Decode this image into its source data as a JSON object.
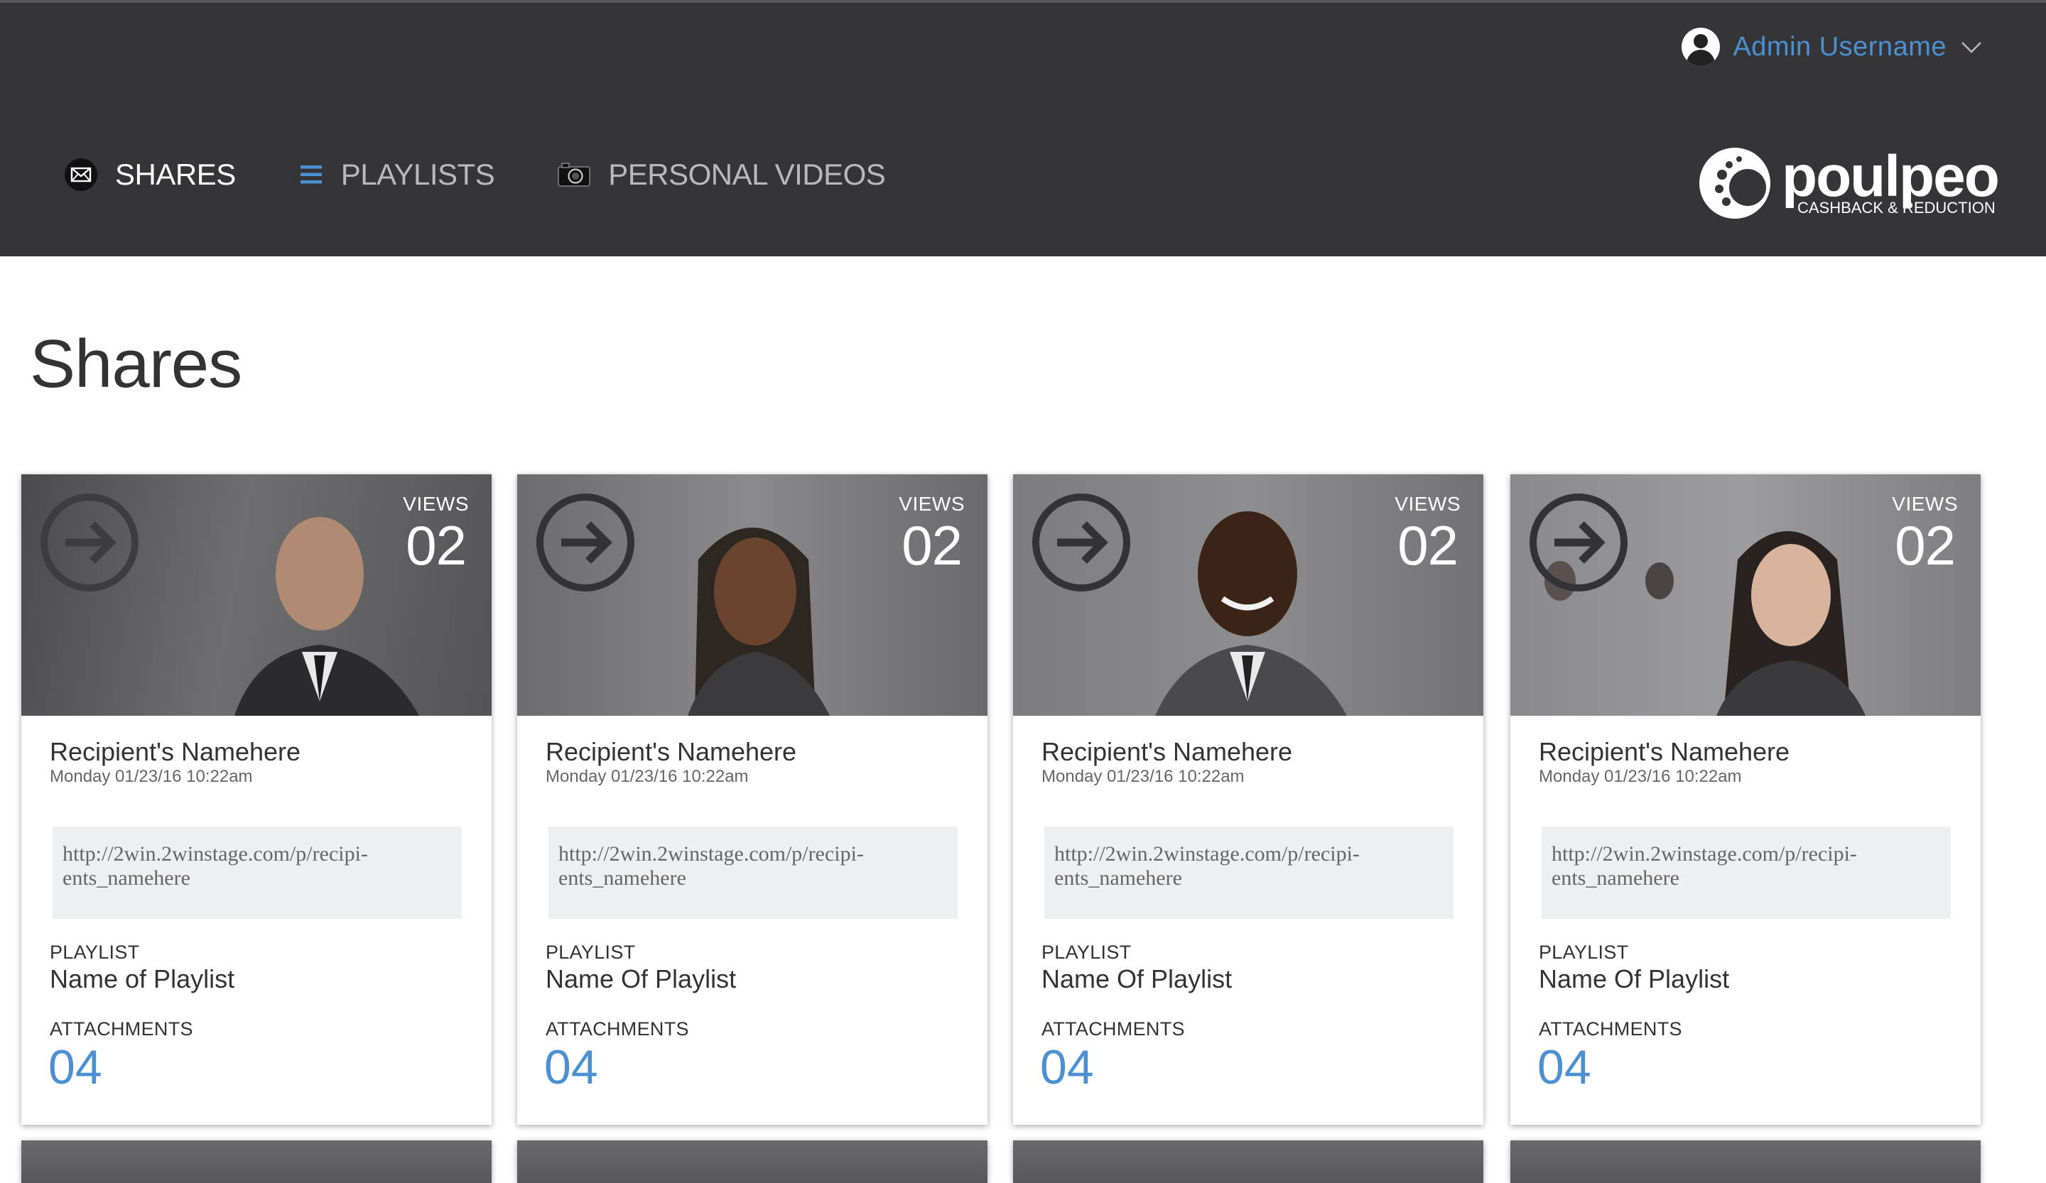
{
  "header": {
    "user_name": "Admin Username",
    "nav": [
      {
        "label": "SHARES",
        "icon": "envelope-icon",
        "active": true
      },
      {
        "label": "PLAYLISTS",
        "icon": "list-icon",
        "active": false
      },
      {
        "label": "PERSONAL VIDEOS",
        "icon": "camera-icon",
        "active": false
      }
    ],
    "logo": {
      "word": "poulpeo",
      "tagline": "CASHBACK & REDUCTION"
    }
  },
  "colors": {
    "header_bg": "#353537",
    "accent": "#4a90d2",
    "link_box_bg": "#eeeff0"
  },
  "page": {
    "title": "Shares"
  },
  "cards": [
    {
      "views_label": "VIEWS",
      "views": "02",
      "recipient": "Recipient's Namehere",
      "date": "Monday 01/23/16 10:22am",
      "link_line1": "http://2win.2winstage.com/p/recipi-",
      "link_line2": "ents_namehere",
      "playlist_label": "PLAYLIST",
      "playlist_name": "Name of Playlist",
      "attachments_label": "ATTACHMENTS",
      "attachments": "04"
    },
    {
      "views_label": "VIEWS",
      "views": "02",
      "recipient": "Recipient's Namehere",
      "date": "Monday 01/23/16 10:22am",
      "link_line1": "http://2win.2winstage.com/p/recipi-",
      "link_line2": "ents_namehere",
      "playlist_label": "PLAYLIST",
      "playlist_name": "Name Of Playlist",
      "attachments_label": "ATTACHMENTS",
      "attachments": "04"
    },
    {
      "views_label": "VIEWS",
      "views": "02",
      "recipient": "Recipient's Namehere",
      "date": "Monday 01/23/16 10:22am",
      "link_line1": "http://2win.2winstage.com/p/recipi-",
      "link_line2": "ents_namehere",
      "playlist_label": "PLAYLIST",
      "playlist_name": "Name Of Playlist",
      "attachments_label": "ATTACHMENTS",
      "attachments": "04"
    },
    {
      "views_label": "VIEWS",
      "views": "02",
      "recipient": "Recipient's Namehere",
      "date": "Monday 01/23/16 10:22am",
      "link_line1": "http://2win.2winstage.com/p/recipi-",
      "link_line2": "ents_namehere",
      "playlist_label": "PLAYLIST",
      "playlist_name": "Name Of Playlist",
      "attachments_label": "ATTACHMENTS",
      "attachments": "04"
    }
  ]
}
